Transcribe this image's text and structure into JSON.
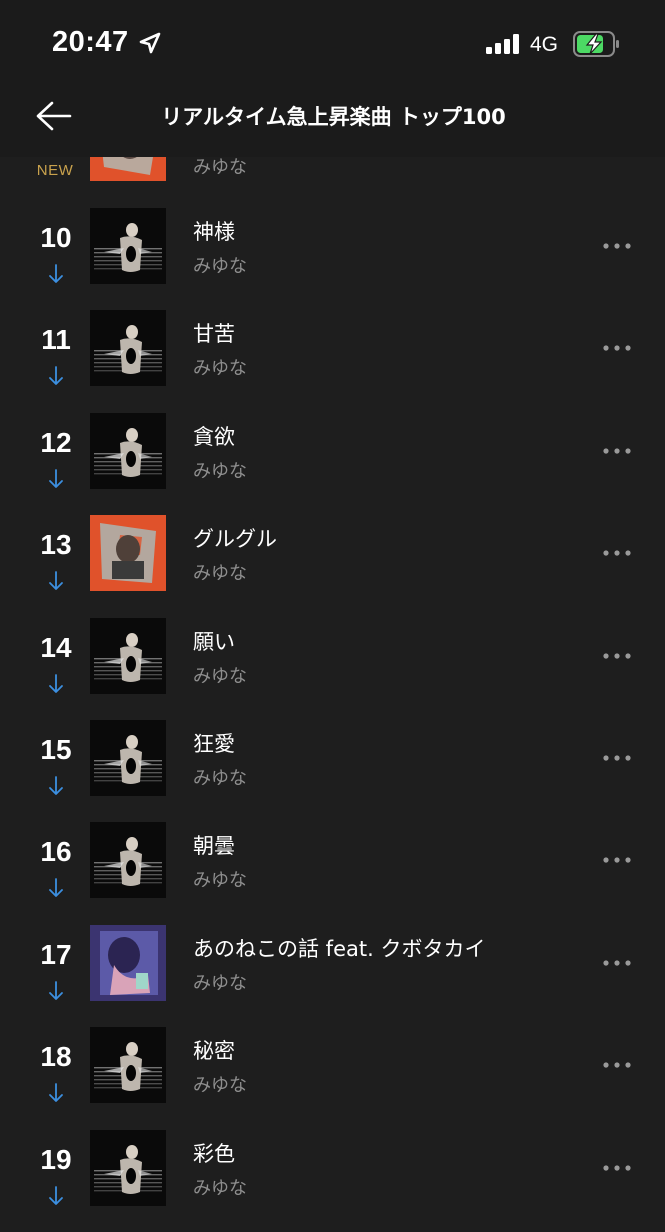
{
  "status_bar": {
    "time": "20:47",
    "network": "4G",
    "battery_color": "#4cd964"
  },
  "header": {
    "title": "リアルタイム急上昇楽曲 トップ100"
  },
  "colors": {
    "background": "#1e1e1e",
    "rank_down": "#3c8fe0",
    "new": "#c9a24d",
    "artist": "#8e8e8e"
  },
  "partial_row": {
    "badge": "NEW",
    "artist": "みゆな",
    "art": "orange"
  },
  "songs": [
    {
      "rank": "10",
      "title": "神様",
      "artist": "みゆな",
      "trend": "down",
      "art": "dark"
    },
    {
      "rank": "11",
      "title": "甘苦",
      "artist": "みゆな",
      "trend": "down",
      "art": "dark"
    },
    {
      "rank": "12",
      "title": "貪欲",
      "artist": "みゆな",
      "trend": "down",
      "art": "dark"
    },
    {
      "rank": "13",
      "title": "グルグル",
      "artist": "みゆな",
      "trend": "down",
      "art": "orange"
    },
    {
      "rank": "14",
      "title": "願い",
      "artist": "みゆな",
      "trend": "down",
      "art": "dark"
    },
    {
      "rank": "15",
      "title": "狂愛",
      "artist": "みゆな",
      "trend": "down",
      "art": "dark"
    },
    {
      "rank": "16",
      "title": "朝曇",
      "artist": "みゆな",
      "trend": "down",
      "art": "dark"
    },
    {
      "rank": "17",
      "title": "あのねこの話 feat. クボタカイ",
      "artist": "みゆな",
      "trend": "down",
      "art": "purple"
    },
    {
      "rank": "18",
      "title": "秘密",
      "artist": "みゆな",
      "trend": "down",
      "art": "dark"
    },
    {
      "rank": "19",
      "title": "彩色",
      "artist": "みゆな",
      "trend": "down",
      "art": "dark"
    }
  ]
}
